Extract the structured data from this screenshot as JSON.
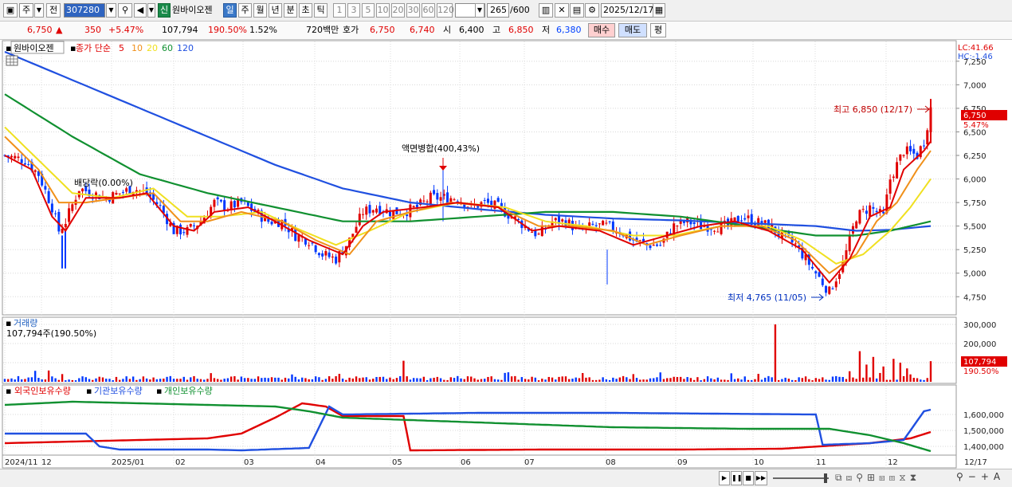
{
  "toolbar": {
    "period_type": "주",
    "prev_label": "전",
    "code": "307280",
    "shin_badge": "신",
    "stock_name": "원바이오젠",
    "periods": [
      "일",
      "주",
      "월",
      "년",
      "분",
      "초",
      "틱"
    ],
    "active_period": "일",
    "intervals": [
      "1",
      "3",
      "5",
      "10",
      "20",
      "30",
      "60",
      "120"
    ],
    "count": "265",
    "count_total": "/600",
    "date": "2025/12/17"
  },
  "quote": {
    "price": "6,750",
    "change": "350",
    "change_pct": "+5.47%",
    "volume": "107,794",
    "vol_ratio": "190.50%",
    "turnover": "1.52%",
    "amount": "720백만",
    "hoga_label": "호가",
    "ask": "6,750",
    "bid": "6,740",
    "open_label": "시",
    "open": "6,400",
    "high_label": "고",
    "high": "6,850",
    "low_label": "저",
    "low": "6,380",
    "buy_label": "매수",
    "sell_label": "매도",
    "eval_label": "평"
  },
  "price_panel": {
    "stock_name": "원바이오젠",
    "ma_title": "종가 단순",
    "ma_periods": [
      "5",
      "10",
      "20",
      "60",
      "120"
    ],
    "lc": "LC:41.66",
    "hc": "HC:-1.46",
    "max_label": "최고 6,850 (12/17)",
    "min_label": "최저 4,765 (11/05)",
    "split_label": "액면병합(400,43%)",
    "dividend_label": "배당락(0.00%)",
    "last_price_tag": "6,750",
    "last_pct_tag": "5.47%"
  },
  "volume_panel": {
    "title": "거래량",
    "sub": "107,794주(190.50%)",
    "last_tag": "107,794",
    "last_pct_tag": "190.50%"
  },
  "holdings_panel": {
    "legend": [
      "외국인보유수량",
      "기관보유수량",
      "개인보유수량"
    ]
  },
  "time_axis": [
    "2024/11",
    "12",
    "2025/01",
    "02",
    "03",
    "04",
    "05",
    "06",
    "07",
    "08",
    "09",
    "10",
    "11",
    "12",
    "12/17"
  ],
  "colors": {
    "up": "#e00000",
    "down": "#0038ff",
    "ma5": "#e00000",
    "ma10": "#f0901a",
    "ma20": "#f0e020",
    "ma60": "#109030",
    "ma120": "#2050e0",
    "foreign": "#e00000",
    "inst": "#2050e0",
    "indiv": "#109030"
  },
  "chart_data": [
    {
      "type": "line",
      "name": "price",
      "yticks": [
        4750,
        5000,
        5250,
        5500,
        5750,
        6000,
        6250,
        6500,
        6750,
        7000,
        7250
      ],
      "ylim": [
        4600,
        7350
      ],
      "max": {
        "value": 6850,
        "date": "12/17"
      },
      "min": {
        "value": 4765,
        "date": "11/05"
      },
      "close_path": [
        [
          0,
          6250
        ],
        [
          6,
          6200
        ],
        [
          10,
          6050
        ],
        [
          14,
          5700
        ],
        [
          16,
          5450
        ],
        [
          18,
          5550
        ],
        [
          22,
          5900
        ],
        [
          26,
          5850
        ],
        [
          30,
          5800
        ],
        [
          34,
          5850
        ],
        [
          38,
          5900
        ],
        [
          42,
          5850
        ],
        [
          46,
          5700
        ],
        [
          50,
          5450
        ],
        [
          54,
          5450
        ],
        [
          58,
          5550
        ],
        [
          62,
          5750
        ],
        [
          66,
          5700
        ],
        [
          70,
          5750
        ],
        [
          74,
          5650
        ],
        [
          78,
          5550
        ],
        [
          82,
          5550
        ],
        [
          86,
          5400
        ],
        [
          90,
          5350
        ],
        [
          94,
          5200
        ],
        [
          98,
          5150
        ],
        [
          102,
          5350
        ],
        [
          106,
          5650
        ],
        [
          110,
          5700
        ],
        [
          114,
          5650
        ],
        [
          118,
          5650
        ],
        [
          122,
          5700
        ],
        [
          126,
          5800
        ],
        [
          130,
          5800
        ],
        [
          134,
          5800
        ],
        [
          138,
          5700
        ],
        [
          142,
          5750
        ],
        [
          146,
          5700
        ],
        [
          150,
          5600
        ],
        [
          154,
          5500
        ],
        [
          158,
          5400
        ],
        [
          162,
          5550
        ],
        [
          166,
          5550
        ],
        [
          170,
          5450
        ],
        [
          174,
          5500
        ],
        [
          178,
          5500
        ],
        [
          182,
          5450
        ],
        [
          186,
          5350
        ],
        [
          190,
          5300
        ],
        [
          194,
          5300
        ],
        [
          198,
          5500
        ],
        [
          202,
          5550
        ],
        [
          206,
          5500
        ],
        [
          210,
          5500
        ],
        [
          214,
          5500
        ],
        [
          218,
          5600
        ],
        [
          222,
          5550
        ],
        [
          226,
          5500
        ],
        [
          230,
          5400
        ],
        [
          234,
          5300
        ],
        [
          238,
          5100
        ],
        [
          242,
          4900
        ],
        [
          244,
          4800
        ],
        [
          248,
          5100
        ],
        [
          252,
          5600
        ],
        [
          256,
          5700
        ],
        [
          260,
          5600
        ],
        [
          262,
          6000
        ],
        [
          266,
          6300
        ],
        [
          270,
          6250
        ],
        [
          272,
          6400
        ],
        [
          274,
          6750
        ]
      ],
      "ma5_path": [
        [
          0,
          6250
        ],
        [
          8,
          6100
        ],
        [
          14,
          5600
        ],
        [
          18,
          5450
        ],
        [
          24,
          5800
        ],
        [
          34,
          5800
        ],
        [
          42,
          5850
        ],
        [
          50,
          5500
        ],
        [
          56,
          5450
        ],
        [
          62,
          5650
        ],
        [
          72,
          5700
        ],
        [
          80,
          5550
        ],
        [
          90,
          5350
        ],
        [
          100,
          5200
        ],
        [
          106,
          5500
        ],
        [
          112,
          5650
        ],
        [
          124,
          5700
        ],
        [
          134,
          5750
        ],
        [
          146,
          5700
        ],
        [
          156,
          5450
        ],
        [
          164,
          5500
        ],
        [
          176,
          5450
        ],
        [
          186,
          5300
        ],
        [
          196,
          5400
        ],
        [
          206,
          5500
        ],
        [
          216,
          5550
        ],
        [
          226,
          5450
        ],
        [
          236,
          5250
        ],
        [
          244,
          4900
        ],
        [
          250,
          5150
        ],
        [
          256,
          5600
        ],
        [
          262,
          5700
        ],
        [
          266,
          6100
        ],
        [
          272,
          6300
        ],
        [
          274,
          6400
        ]
      ],
      "ma10_path": [
        [
          0,
          6450
        ],
        [
          10,
          6100
        ],
        [
          16,
          5750
        ],
        [
          24,
          5750
        ],
        [
          34,
          5800
        ],
        [
          44,
          5850
        ],
        [
          52,
          5550
        ],
        [
          60,
          5550
        ],
        [
          70,
          5650
        ],
        [
          82,
          5550
        ],
        [
          92,
          5350
        ],
        [
          102,
          5200
        ],
        [
          110,
          5550
        ],
        [
          120,
          5650
        ],
        [
          132,
          5750
        ],
        [
          146,
          5700
        ],
        [
          158,
          5500
        ],
        [
          168,
          5500
        ],
        [
          180,
          5450
        ],
        [
          190,
          5300
        ],
        [
          200,
          5400
        ],
        [
          212,
          5500
        ],
        [
          224,
          5500
        ],
        [
          234,
          5350
        ],
        [
          244,
          5000
        ],
        [
          252,
          5200
        ],
        [
          258,
          5550
        ],
        [
          264,
          5750
        ],
        [
          270,
          6100
        ],
        [
          274,
          6300
        ]
      ],
      "ma20_path": [
        [
          0,
          6550
        ],
        [
          10,
          6200
        ],
        [
          20,
          5850
        ],
        [
          32,
          5800
        ],
        [
          44,
          5900
        ],
        [
          54,
          5600
        ],
        [
          64,
          5600
        ],
        [
          76,
          5650
        ],
        [
          88,
          5450
        ],
        [
          98,
          5300
        ],
        [
          108,
          5450
        ],
        [
          120,
          5650
        ],
        [
          134,
          5750
        ],
        [
          148,
          5700
        ],
        [
          160,
          5550
        ],
        [
          172,
          5500
        ],
        [
          186,
          5400
        ],
        [
          198,
          5400
        ],
        [
          212,
          5500
        ],
        [
          226,
          5500
        ],
        [
          236,
          5350
        ],
        [
          246,
          5100
        ],
        [
          254,
          5200
        ],
        [
          262,
          5450
        ],
        [
          268,
          5700
        ],
        [
          274,
          6000
        ]
      ],
      "ma60_path": [
        [
          0,
          6900
        ],
        [
          20,
          6450
        ],
        [
          40,
          6050
        ],
        [
          60,
          5850
        ],
        [
          80,
          5700
        ],
        [
          100,
          5550
        ],
        [
          120,
          5550
        ],
        [
          140,
          5600
        ],
        [
          160,
          5650
        ],
        [
          180,
          5650
        ],
        [
          200,
          5600
        ],
        [
          220,
          5500
        ],
        [
          240,
          5400
        ],
        [
          252,
          5400
        ],
        [
          262,
          5450
        ],
        [
          274,
          5550
        ]
      ],
      "ma120_path": [
        [
          0,
          7350
        ],
        [
          20,
          7050
        ],
        [
          40,
          6750
        ],
        [
          60,
          6450
        ],
        [
          80,
          6150
        ],
        [
          100,
          5900
        ],
        [
          120,
          5750
        ],
        [
          140,
          5680
        ],
        [
          160,
          5620
        ],
        [
          180,
          5580
        ],
        [
          200,
          5560
        ],
        [
          220,
          5530
        ],
        [
          240,
          5500
        ],
        [
          252,
          5450
        ],
        [
          262,
          5460
        ],
        [
          274,
          5500
        ]
      ]
    },
    {
      "type": "bar",
      "name": "volume",
      "yticks": [
        100000,
        200000,
        300000
      ],
      "ylim": [
        0,
        300000
      ],
      "last": 107794,
      "spikes": [
        [
          118,
          110000
        ],
        [
          228,
          300000
        ],
        [
          253,
          160000
        ],
        [
          255,
          90000
        ],
        [
          257,
          130000
        ],
        [
          260,
          80000
        ],
        [
          263,
          120000
        ],
        [
          265,
          100000
        ],
        [
          267,
          70000
        ],
        [
          274,
          107794
        ]
      ]
    },
    {
      "type": "line",
      "name": "holdings",
      "yticks": [
        1400000,
        1500000,
        1600000
      ],
      "ylim": [
        1350000,
        1700000
      ],
      "series": [
        {
          "name": "외국인보유수량",
          "path": [
            [
              0,
              1420000
            ],
            [
              20,
              1430000
            ],
            [
              40,
              1440000
            ],
            [
              60,
              1450000
            ],
            [
              70,
              1480000
            ],
            [
              80,
              1580000
            ],
            [
              88,
              1670000
            ],
            [
              95,
              1650000
            ],
            [
              100,
              1590000
            ],
            [
              118,
              1590000
            ],
            [
              120,
              1375000
            ],
            [
              160,
              1380000
            ],
            [
              200,
              1380000
            ],
            [
              230,
              1385000
            ],
            [
              256,
              1420000
            ],
            [
              268,
              1450000
            ],
            [
              274,
              1490000
            ]
          ]
        },
        {
          "name": "기관보유수량",
          "path": [
            [
              0,
              1480000
            ],
            [
              20,
              1480000
            ],
            [
              24,
              1480000
            ],
            [
              28,
              1400000
            ],
            [
              34,
              1380000
            ],
            [
              60,
              1380000
            ],
            [
              70,
              1375000
            ],
            [
              90,
              1390000
            ],
            [
              96,
              1650000
            ],
            [
              100,
              1600000
            ],
            [
              140,
              1610000
            ],
            [
              180,
              1610000
            ],
            [
              240,
              1600000
            ],
            [
              242,
              1410000
            ],
            [
              256,
              1420000
            ],
            [
              266,
              1440000
            ],
            [
              272,
              1620000
            ],
            [
              274,
              1630000
            ]
          ]
        },
        {
          "name": "개인보유수량",
          "path": [
            [
              0,
              1660000
            ],
            [
              20,
              1680000
            ],
            [
              40,
              1670000
            ],
            [
              60,
              1660000
            ],
            [
              80,
              1650000
            ],
            [
              90,
              1620000
            ],
            [
              100,
              1580000
            ],
            [
              140,
              1550000
            ],
            [
              180,
              1520000
            ],
            [
              220,
              1510000
            ],
            [
              244,
              1510000
            ],
            [
              256,
              1470000
            ],
            [
              266,
              1420000
            ],
            [
              274,
              1370000
            ]
          ]
        }
      ]
    }
  ]
}
